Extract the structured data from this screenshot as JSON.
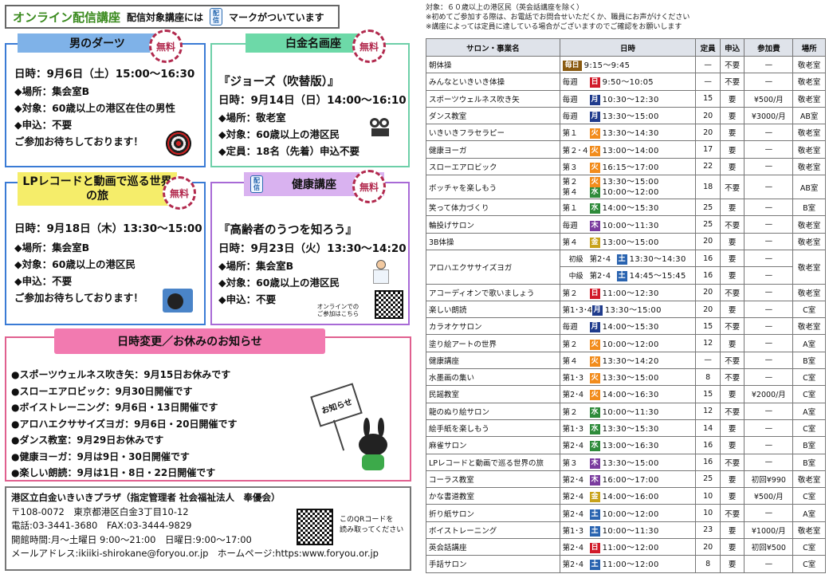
{
  "header": {
    "title": "オンライン配信講座",
    "subtitle": "配信対象講座には",
    "mark_label": "マークがついています",
    "icon_text": "配信"
  },
  "free_label": "無料",
  "icon_text": "配信",
  "cards": [
    {
      "title": "男のダーツ",
      "date": "日時：9月6日（土）15:00～16:30",
      "lines": [
        "◆場所：集会室B",
        "◆対象：60歳以上の港区在住の男性",
        "◆申込：不要"
      ],
      "footer": "ご参加お待ちしております！"
    },
    {
      "title": "白金名画座",
      "movie": "『ジョーズ（吹替版）』",
      "date": "日時：9月14日（日）14:00～16:10",
      "lines": [
        "◆場所：敬老室",
        "◆対象：60歳以上の港区民",
        "◆定員：18名（先着）申込不要"
      ]
    },
    {
      "title": "LPレコードと動画で巡る世界の旅",
      "date": "日時：9月18日（木）13:30～15:00",
      "lines": [
        "◆場所：集会室B",
        "◆対象：60歳以上の港区民",
        "◆申込：不要"
      ],
      "footer": "ご参加お待ちしております！"
    },
    {
      "title": "健康講座",
      "lecture": "『高齢者のうつを知ろう』",
      "date": "日時：9月23日（火）13:30～14:20",
      "lines": [
        "◆場所：集会室B",
        "◆対象：60歳以上の港区民",
        "◆申込：不要"
      ],
      "online_note1": "オンラインでの",
      "online_note2": "ご参加はこちら"
    }
  ],
  "notice": {
    "title": "日時変更／お休みのお知らせ",
    "items": [
      "●スポーツウェルネス吹き矢：9月15日お休みです",
      "●スローエアロビック：9月30日開催です",
      "●ボイストレーニング：9月6日・13日開催です",
      "●アロハエクササイズヨガ：9月6日・20日開催です",
      "●ダンス教室：9月29日お休みです",
      "●健康ヨーガ：9月は9日・30日開催です",
      "●楽しい朗読：9月は1日・8日・22日開催です"
    ],
    "sign": "お知らせ"
  },
  "info": {
    "name": "港区立白金いきいきプラザ（指定管理者 社会福祉法人　奉優会）",
    "address": "〒108-0072　東京都港区白金3丁目10-12",
    "phone": "電話:03-3441-3680　FAX:03-3444-9829",
    "hours": "開館時間:月～土曜日 9:00～21:00　日曜日:9:00～17:00",
    "web": "メールアドレス:ikiiki-shirokane@foryou.or.jp　ホームページ:https:www.foryou.or.jp",
    "qr_note1": "このQRコードを",
    "qr_note2": "読み取ってください"
  },
  "notes": [
    "対象：６０歳以上の港区民（英会話講座を除く）",
    "※初めてご参加する際は、お電話でお問合せいただくか、職員にお声がけください",
    "※講座によっては定員に達している場合がございますのでご確認をお願いします"
  ],
  "table": {
    "headers": [
      "サロン・事業名",
      "日時",
      "定員",
      "申込",
      "参加費",
      "場所"
    ],
    "rows": [
      {
        "name": "朝体操",
        "freq": "",
        "day": "毎日",
        "dc": "ev",
        "time": "9:15～9:45",
        "cap": "—",
        "app": "不要",
        "fee": "—",
        "place": "敬老室"
      },
      {
        "name": "みんなといきいき体操",
        "freq": "毎週",
        "day": "日",
        "dc": "sun",
        "time": "9:50～10:05",
        "cap": "—",
        "app": "不要",
        "fee": "—",
        "place": "敬老室"
      },
      {
        "name": "スポーツウェルネス吹き矢",
        "freq": "毎週",
        "day": "月",
        "dc": "mon",
        "time": "10:30～12:30",
        "cap": "15",
        "app": "要",
        "fee": "¥500/月",
        "place": "敬老室"
      },
      {
        "name": "ダンス教室",
        "freq": "毎週",
        "day": "月",
        "dc": "mon",
        "time": "13:30～15:00",
        "cap": "20",
        "app": "要",
        "fee": "¥3000/月",
        "place": "AB室"
      },
      {
        "name": "いきいきフラセラピー",
        "freq": "第１",
        "day": "火",
        "dc": "tue",
        "time": "13:30～14:30",
        "cap": "20",
        "app": "要",
        "fee": "—",
        "place": "敬老室"
      },
      {
        "name": "健康ヨーガ",
        "freq": "第２･４",
        "day": "火",
        "dc": "tue",
        "time": "13:00～14:00",
        "cap": "17",
        "app": "要",
        "fee": "—",
        "place": "敬老室"
      },
      {
        "name": "スローエアロビック",
        "freq": "第３",
        "day": "火",
        "dc": "tue",
        "time": "16:15～17:00",
        "cap": "22",
        "app": "要",
        "fee": "—",
        "place": "敬老室"
      },
      {
        "name": "ボッチャを楽しもう",
        "freq": "第２",
        "day": "火",
        "dc": "tue",
        "time": "13:30～15:00",
        "freq2": "第４",
        "day2": "水",
        "dc2": "wed",
        "time2": "10:00～12:00",
        "cap": "18",
        "app": "不要",
        "fee": "—",
        "place": "AB室"
      },
      {
        "name": "笑って体力づくり",
        "freq": "第１",
        "day": "水",
        "dc": "wed",
        "time": "14:00～15:30",
        "cap": "25",
        "app": "要",
        "fee": "—",
        "place": "B室"
      },
      {
        "name": "輪投げサロン",
        "freq": "毎週",
        "day": "木",
        "dc": "thu",
        "time": "10:00～11:30",
        "cap": "25",
        "app": "不要",
        "fee": "—",
        "place": "敬老室"
      },
      {
        "name": "3B体操",
        "freq": "第４",
        "day": "金",
        "dc": "fri",
        "time": "13:00～15:00",
        "cap": "20",
        "app": "要",
        "fee": "—",
        "place": "敬老室"
      },
      {
        "name": "アロハエクササイズヨガ",
        "level": "初級",
        "freq": "第2･4",
        "day": "土",
        "dc": "sat",
        "time": "13:30～14:30",
        "cap": "16",
        "app": "要",
        "fee": "—",
        "place": "敬老室"
      },
      {
        "name": "",
        "level": "中級",
        "freq": "第2･4",
        "day": "土",
        "dc": "sat",
        "time": "14:45～15:45",
        "cap": "16",
        "app": "要",
        "fee": "—",
        "place": ""
      },
      {
        "name": "アコーディオンで歌いましょう",
        "freq": "第２",
        "day": "日",
        "dc": "sun",
        "time": "11:00～12:30",
        "cap": "20",
        "app": "不要",
        "fee": "—",
        "place": "敬老室"
      },
      {
        "name": "楽しい朗読",
        "freq": "第1･3･4",
        "day": "月",
        "dc": "mon",
        "time": "13:30～15:00",
        "cap": "20",
        "app": "要",
        "fee": "—",
        "place": "C室"
      },
      {
        "name": "カラオケサロン",
        "freq": "毎週",
        "day": "月",
        "dc": "mon",
        "time": "14:00～15:30",
        "cap": "15",
        "app": "不要",
        "fee": "—",
        "place": "敬老室"
      },
      {
        "name": "塗り絵アートの世界",
        "freq": "第２",
        "day": "火",
        "dc": "tue",
        "time": "10:00～12:00",
        "cap": "12",
        "app": "要",
        "fee": "—",
        "place": "A室"
      },
      {
        "name": "健康講座",
        "freq": "第４",
        "day": "火",
        "dc": "tue",
        "time": "13:30～14:20",
        "cap": "—",
        "app": "不要",
        "fee": "—",
        "place": "B室"
      },
      {
        "name": "水墨画の集い",
        "freq": "第1･3",
        "day": "火",
        "dc": "tue",
        "time": "13:30～15:00",
        "cap": "8",
        "app": "不要",
        "fee": "—",
        "place": "C室"
      },
      {
        "name": "民謡教室",
        "freq": "第2･4",
        "day": "火",
        "dc": "tue",
        "time": "14:00～16:30",
        "cap": "15",
        "app": "要",
        "fee": "¥2000/月",
        "place": "C室"
      },
      {
        "name": "龍のぬり絵サロン",
        "freq": "第２",
        "day": "水",
        "dc": "wed",
        "time": "10:00～11:30",
        "cap": "12",
        "app": "不要",
        "fee": "—",
        "place": "A室"
      },
      {
        "name": "絵手紙を楽しもう",
        "freq": "第1･3",
        "day": "水",
        "dc": "wed",
        "time": "13:30～15:30",
        "cap": "14",
        "app": "要",
        "fee": "—",
        "place": "C室"
      },
      {
        "name": "麻雀サロン",
        "freq": "第2･4",
        "day": "水",
        "dc": "wed",
        "time": "13:00～16:30",
        "cap": "16",
        "app": "要",
        "fee": "—",
        "place": "B室"
      },
      {
        "name": "LPレコードと動画で巡る世界の旅",
        "freq": "第３",
        "day": "木",
        "dc": "thu",
        "time": "13:30～15:00",
        "cap": "16",
        "app": "不要",
        "fee": "—",
        "place": "B室"
      },
      {
        "name": "コーラス教室",
        "freq": "第2･4",
        "day": "木",
        "dc": "thu",
        "time": "16:00～17:00",
        "cap": "25",
        "app": "要",
        "fee": "初回¥990",
        "place": "敬老室"
      },
      {
        "name": "かな書道教室",
        "freq": "第2･4",
        "day": "金",
        "dc": "fri",
        "time": "14:00～16:00",
        "cap": "10",
        "app": "要",
        "fee": "¥500/月",
        "place": "C室"
      },
      {
        "name": "折り紙サロン",
        "freq": "第2･4",
        "day": "土",
        "dc": "sat",
        "time": "10:00～12:00",
        "cap": "10",
        "app": "不要",
        "fee": "—",
        "place": "A室"
      },
      {
        "name": "ボイストレーニング",
        "freq": "第1･3",
        "day": "土",
        "dc": "sat",
        "time": "10:00～11:30",
        "cap": "23",
        "app": "要",
        "fee": "¥1000/月",
        "place": "敬老室"
      },
      {
        "name": "英会話講座",
        "freq": "第2･4",
        "day": "日",
        "dc": "sun",
        "time": "11:00～12:00",
        "cap": "20",
        "app": "要",
        "fee": "初回¥500",
        "place": "C室"
      },
      {
        "name": "手話サロン",
        "freq": "第2･4",
        "day": "土",
        "dc": "sat",
        "time": "11:00～12:00",
        "cap": "8",
        "app": "要",
        "fee": "—",
        "place": "C室"
      }
    ]
  }
}
